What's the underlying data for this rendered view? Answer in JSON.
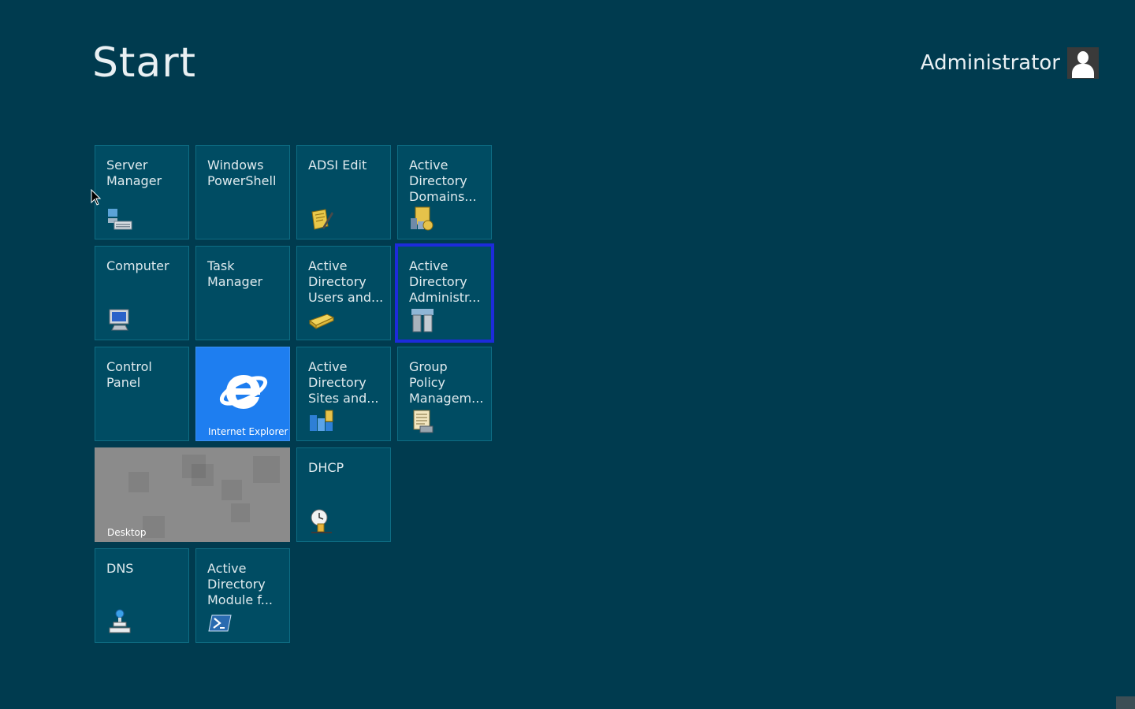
{
  "header": {
    "title": "Start"
  },
  "user": {
    "name": "Administrator"
  },
  "tiles": {
    "server_manager": "Server\nManager",
    "powershell": "Windows\nPowerShell",
    "adsi_edit": "ADSI Edit",
    "ad_domains": "Active\nDirectory\nDomains...",
    "computer": "Computer",
    "task_manager": "Task\nManager",
    "ad_users": "Active\nDirectory\nUsers and...",
    "ad_admin": "Active\nDirectory\nAdministr...",
    "control_panel": "Control\nPanel",
    "ie": "Internet Explorer",
    "ad_sites": "Active\nDirectory\nSites and...",
    "gpm": "Group\nPolicy\nManagem...",
    "desktop": "Desktop",
    "dhcp": "DHCP",
    "dns": "DNS",
    "ad_module": "Active\nDirectory\nModule f..."
  },
  "colors": {
    "background": "#003b4f",
    "tile": "#004c63",
    "ie_tile": "#1e7ef0",
    "desktop_tile": "#8b8b8b",
    "selection": "#1d2bdb"
  }
}
